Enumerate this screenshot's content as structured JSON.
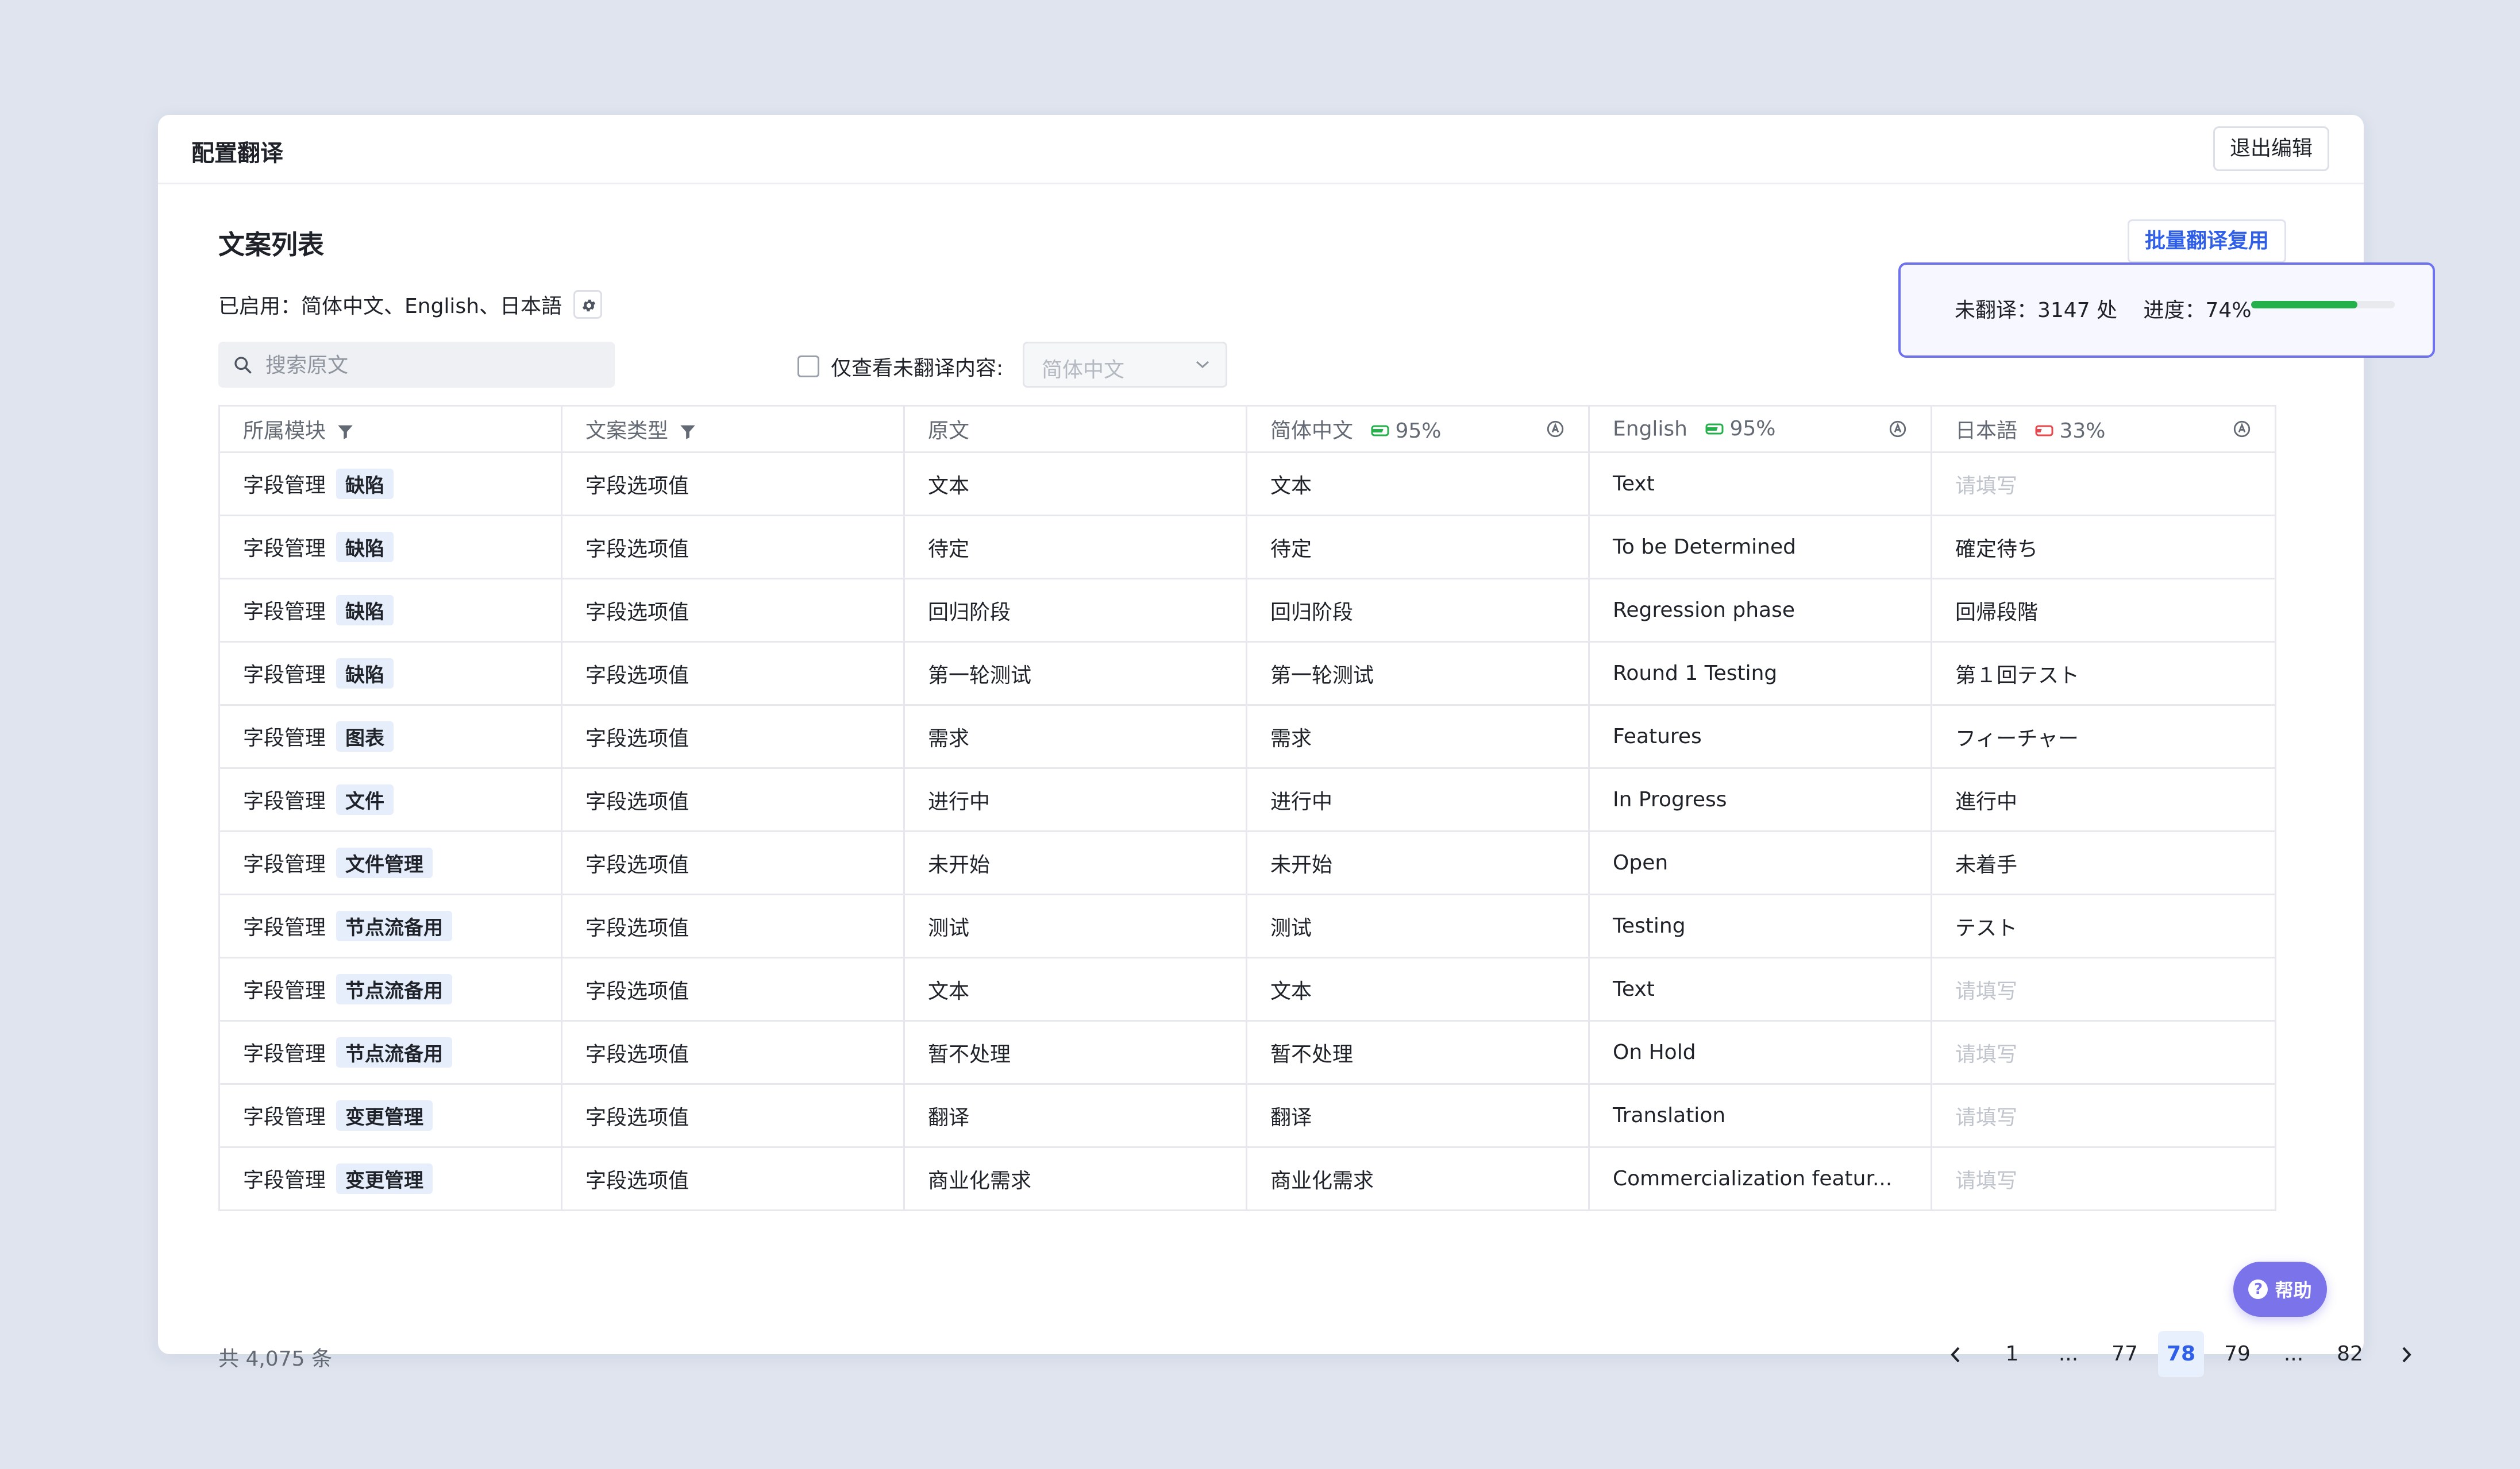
{
  "header": {
    "title": "配置翻译",
    "exit_label": "退出编辑"
  },
  "section": {
    "title": "文案列表",
    "batch_label": "批量翻译复用",
    "enabled_label": "已启用：",
    "enabled_langs": "简体中文、English、日本語"
  },
  "progress": {
    "untranslated_text": "未翻译：3147 处",
    "progress_text": "进度：74%",
    "percent": 74
  },
  "filters": {
    "search_placeholder": "搜索原文",
    "untranslated_only_label": "仅查看未翻译内容:",
    "lang_select_value": "简体中文"
  },
  "table": {
    "columns": [
      {
        "label": "所属模块"
      },
      {
        "label": "文案类型"
      },
      {
        "label": "原文"
      },
      {
        "label": "简体中文",
        "pct": "95%"
      },
      {
        "label": "English",
        "pct": "95%"
      },
      {
        "label": "日本語",
        "pct": "33%"
      }
    ],
    "rows": [
      {
        "module": "字段管理",
        "tag": "缺陷",
        "type": "字段选项值",
        "source": "文本",
        "zh": "文本",
        "en": "Text",
        "ja": "请填写",
        "ja_empty": true
      },
      {
        "module": "字段管理",
        "tag": "缺陷",
        "type": "字段选项值",
        "source": "待定",
        "zh": "待定",
        "en": "To be Determined",
        "ja": "確定待ち",
        "ja_empty": false
      },
      {
        "module": "字段管理",
        "tag": "缺陷",
        "type": "字段选项值",
        "source": "回归阶段",
        "zh": "回归阶段",
        "en": "Regression phase",
        "ja": "回帰段階",
        "ja_empty": false
      },
      {
        "module": "字段管理",
        "tag": "缺陷",
        "type": "字段选项值",
        "source": "第一轮测试",
        "zh": "第一轮测试",
        "en": "Round 1 Testing",
        "ja": "第１回テスト",
        "ja_empty": false
      },
      {
        "module": "字段管理",
        "tag": "图表",
        "type": "字段选项值",
        "source": "需求",
        "zh": "需求",
        "en": "Features",
        "ja": "フィーチャー",
        "ja_empty": false
      },
      {
        "module": "字段管理",
        "tag": "文件",
        "type": "字段选项值",
        "source": "进行中",
        "zh": "进行中",
        "en": "In Progress",
        "ja": "進行中",
        "ja_empty": false
      },
      {
        "module": "字段管理",
        "tag": "文件管理",
        "type": "字段选项值",
        "source": "未开始",
        "zh": "未开始",
        "en": "Open",
        "ja": "未着手",
        "ja_empty": false
      },
      {
        "module": "字段管理",
        "tag": "节点流备用",
        "type": "字段选项值",
        "source": "测试",
        "zh": "测试",
        "en": "Testing",
        "ja": "テスト",
        "ja_empty": false
      },
      {
        "module": "字段管理",
        "tag": "节点流备用",
        "type": "字段选项值",
        "source": "文本",
        "zh": "文本",
        "en": "Text",
        "ja": "请填写",
        "ja_empty": true
      },
      {
        "module": "字段管理",
        "tag": "节点流备用",
        "type": "字段选项值",
        "source": "暂不处理",
        "zh": "暂不处理",
        "en": "On Hold",
        "ja": "请填写",
        "ja_empty": true
      },
      {
        "module": "字段管理",
        "tag": "变更管理",
        "type": "字段选项值",
        "source": "翻译",
        "zh": "翻译",
        "en": "Translation",
        "ja": "请填写",
        "ja_empty": true
      },
      {
        "module": "字段管理",
        "tag": "变更管理",
        "type": "字段选项值",
        "source": "商业化需求",
        "zh": "商业化需求",
        "en": "Commercialization featur...",
        "ja": "请填写",
        "ja_empty": true
      }
    ]
  },
  "footer": {
    "total": "共 4,075 条",
    "pages": [
      "1",
      "...",
      "77",
      "78",
      "79",
      "...",
      "82"
    ],
    "active_page": "78"
  },
  "help": {
    "label": "帮助"
  },
  "colors": {
    "accent": "#2f5fe8",
    "progress_green": "#24b04b",
    "progress_border": "#6e72f0",
    "help_bg": "#7a73ea",
    "tag_bg": "#e6eefc"
  }
}
